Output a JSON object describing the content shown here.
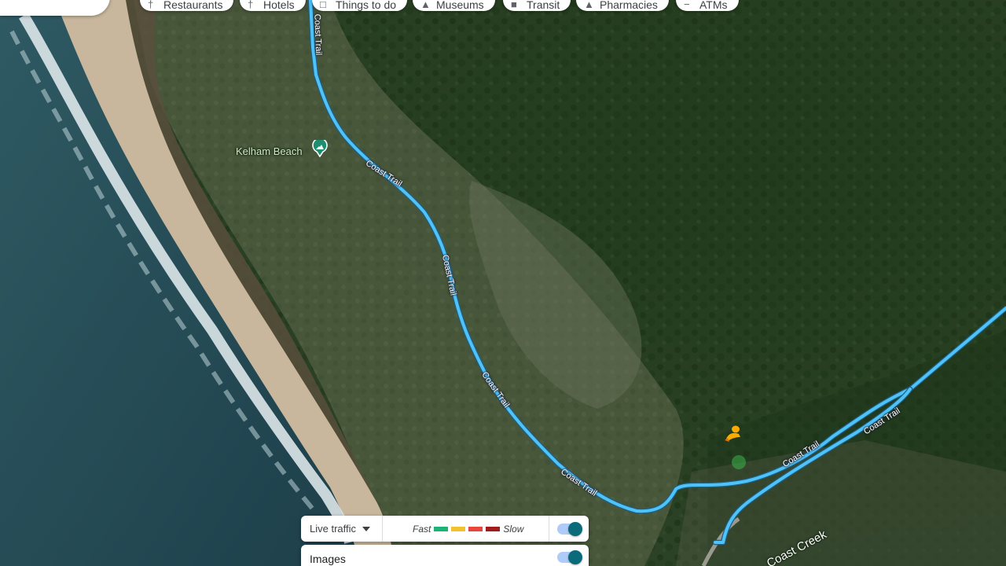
{
  "chips": [
    {
      "label": "Restaurants",
      "icon": "fork-knife-icon"
    },
    {
      "label": "Hotels",
      "icon": "bed-icon"
    },
    {
      "label": "Things to do",
      "icon": "camera-icon"
    },
    {
      "label": "Museums",
      "icon": "museum-icon"
    },
    {
      "label": "Transit",
      "icon": "train-icon"
    },
    {
      "label": "Pharmacies",
      "icon": "pharmacy-icon"
    },
    {
      "label": "ATMs",
      "icon": "atm-icon"
    }
  ],
  "map": {
    "poi": {
      "label": "Kelham Beach",
      "icon": "beach-icon",
      "color": "#1e8e6e"
    },
    "trail_name": "Coast Trail",
    "creek_label": "Coast Creek",
    "trail_color": "#4fc3f7",
    "person_icon": "pegman-icon"
  },
  "traffic_panel": {
    "select_label": "Live traffic",
    "legend_fast": "Fast",
    "legend_slow": "Slow",
    "legend_colors": [
      "#1db377",
      "#f2c12e",
      "#e8453c",
      "#9e1c1c"
    ],
    "toggle_on": true
  },
  "images_panel": {
    "label": "Images",
    "toggle_on": true
  }
}
